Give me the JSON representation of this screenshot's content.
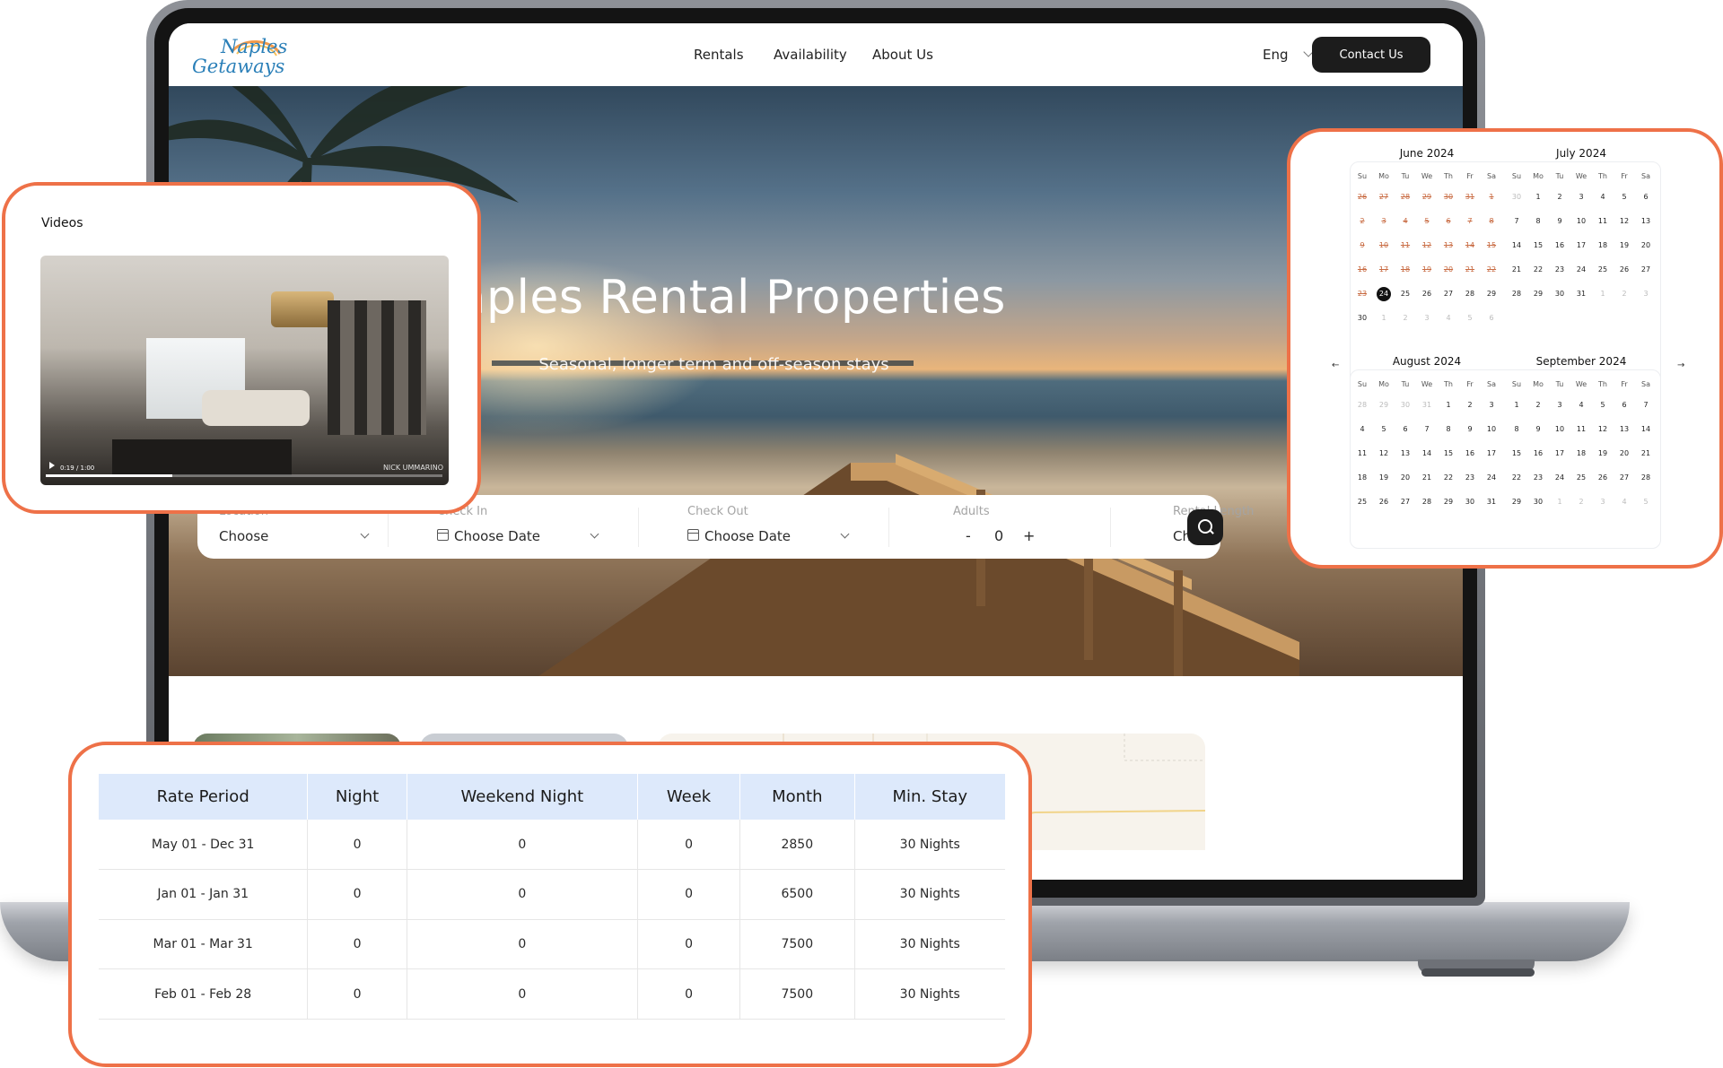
{
  "site": {
    "logo_line1": "Naples",
    "logo_line2": "Getaways",
    "nav": [
      "Rentals",
      "Availability",
      "About Us"
    ],
    "language": "Eng",
    "contact_label": "Contact Us"
  },
  "hero": {
    "title": "Naples Rental Properties",
    "subtitle": "Seasonal, longer term and off-season stays"
  },
  "search": {
    "location": {
      "label": "Location",
      "value": "Choose"
    },
    "check_in": {
      "label": "Check In",
      "value": "Choose Date"
    },
    "check_out": {
      "label": "Check Out",
      "value": "Choose Date"
    },
    "adults": {
      "label": "Adults",
      "minus": "-",
      "value": "0",
      "plus": "+"
    },
    "rental_length": {
      "label": "Rental Length",
      "value": "Choose"
    }
  },
  "video_card": {
    "title": "Videos",
    "time": "0:19 / 1:00",
    "watermark": "NICK UMMARINO",
    "progress": 0.32
  },
  "calendar": {
    "weekdays": [
      "Su",
      "Mo",
      "Tu",
      "We",
      "Th",
      "Fr",
      "Sa"
    ],
    "prev_arrow": "←",
    "next_arrow": "→",
    "months": [
      {
        "title": "June 2024",
        "weeks": [
          [
            "26",
            "27",
            "28",
            "29",
            "30",
            "31",
            "1"
          ],
          [
            "2",
            "3",
            "4",
            "5",
            "6",
            "7",
            "8"
          ],
          [
            "9",
            "10",
            "11",
            "12",
            "13",
            "14",
            "15"
          ],
          [
            "16",
            "17",
            "18",
            "19",
            "20",
            "21",
            "22"
          ],
          [
            "23",
            "24",
            "25",
            "26",
            "27",
            "28",
            "29"
          ],
          [
            "30",
            "1",
            "2",
            "3",
            "4",
            "5",
            "6"
          ]
        ]
      },
      {
        "title": "July 2024",
        "weeks": [
          [
            "30",
            "1",
            "2",
            "3",
            "4",
            "5",
            "6"
          ],
          [
            "7",
            "8",
            "9",
            "10",
            "11",
            "12",
            "13"
          ],
          [
            "14",
            "15",
            "16",
            "17",
            "18",
            "19",
            "20"
          ],
          [
            "21",
            "22",
            "23",
            "24",
            "25",
            "26",
            "27"
          ],
          [
            "28",
            "29",
            "30",
            "31",
            "1",
            "2",
            "3"
          ]
        ]
      },
      {
        "title": "August 2024",
        "weeks": [
          [
            "28",
            "29",
            "30",
            "31",
            "1",
            "2",
            "3"
          ],
          [
            "4",
            "5",
            "6",
            "7",
            "8",
            "9",
            "10"
          ],
          [
            "11",
            "12",
            "13",
            "14",
            "15",
            "16",
            "17"
          ],
          [
            "18",
            "19",
            "20",
            "21",
            "22",
            "23",
            "24"
          ],
          [
            "25",
            "26",
            "27",
            "28",
            "29",
            "30",
            "31"
          ]
        ]
      },
      {
        "title": "September 2024",
        "weeks": [
          [
            "1",
            "2",
            "3",
            "4",
            "5",
            "6",
            "7"
          ],
          [
            "8",
            "9",
            "10",
            "11",
            "12",
            "13",
            "14"
          ],
          [
            "15",
            "16",
            "17",
            "18",
            "19",
            "20",
            "21"
          ],
          [
            "22",
            "23",
            "24",
            "25",
            "26",
            "27",
            "28"
          ],
          [
            "29",
            "30",
            "1",
            "2",
            "3",
            "4",
            "5"
          ]
        ]
      }
    ],
    "selected_date": "24"
  },
  "rates": {
    "headers": [
      "Rate Period",
      "Night",
      "Weekend Night",
      "Week",
      "Month",
      "Min. Stay"
    ],
    "rows": [
      [
        "May 01 - Dec 31",
        "0",
        "0",
        "0",
        "2850",
        "30 Nights"
      ],
      [
        "Jan 01 - Jan 31",
        "0",
        "0",
        "0",
        "6500",
        "30 Nights"
      ],
      [
        "Mar 01 - Mar 31",
        "0",
        "0",
        "0",
        "7500",
        "30 Nights"
      ],
      [
        "Feb 01 - Feb 28",
        "0",
        "0",
        "0",
        "7500",
        "30 Nights"
      ]
    ]
  },
  "colors": {
    "accent_border": "#ee7148",
    "button_dark": "#1c1c1c",
    "table_header_bg": "#dde9fb",
    "past_date": "#c86a41"
  }
}
